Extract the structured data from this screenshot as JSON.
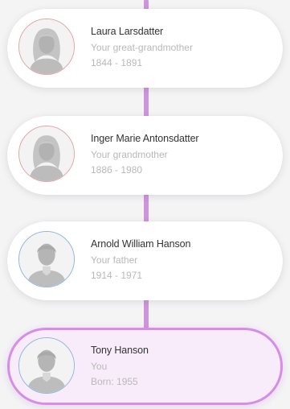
{
  "colors": {
    "connector": "#cf94df",
    "female_ring": "#e3a3a9",
    "male_ring": "#8fb6dd",
    "self_border": "#d78de8",
    "self_background": "#f8ecfb",
    "name_text": "#333333",
    "secondary_text": "#b9b9b9"
  },
  "lineage": [
    {
      "name": "Laura Larsdatter",
      "relation": "Your great-grandmother",
      "dates": "1844 - 1891",
      "gender": "female",
      "avatar_icon": "female-silhouette-icon"
    },
    {
      "name": "Inger Marie Antonsdatter",
      "relation": "Your grandmother",
      "dates": "1886 - 1980",
      "gender": "female",
      "avatar_icon": "female-silhouette-icon"
    },
    {
      "name": "Arnold William Hanson",
      "relation": "Your father",
      "dates": "1914 - 1971",
      "gender": "male",
      "avatar_icon": "male-silhouette-icon"
    },
    {
      "name": "Tony Hanson",
      "relation": "You",
      "dates": "Born: 1955",
      "gender": "male",
      "avatar_icon": "male-silhouette-icon",
      "is_self": true
    }
  ]
}
